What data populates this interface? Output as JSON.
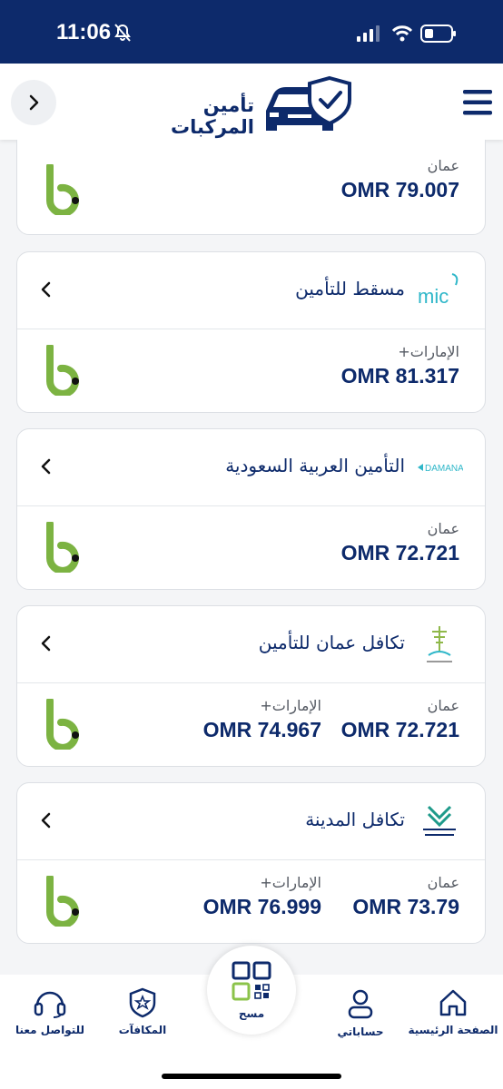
{
  "status_bar": {
    "time": "11:06"
  },
  "header": {
    "title": "تأمين المركبات"
  },
  "cards": [
    {
      "quotes": [
        {
          "region": "عمان",
          "price": "OMR 79.007"
        }
      ]
    },
    {
      "company": "مسقط للتأمين",
      "logo": "mic-logo",
      "quotes": [
        {
          "region": "+الإمارات",
          "price": "OMR 81.317"
        }
      ]
    },
    {
      "company": "التأمين العربية السعودية",
      "logo": "damana-logo",
      "quotes": [
        {
          "region": "عمان",
          "price": "OMR 72.721"
        }
      ]
    },
    {
      "company": "تكافل عمان للتأمين",
      "logo": "takaful-oman-logo",
      "quotes": [
        {
          "region": "عمان",
          "price": "OMR 72.721"
        },
        {
          "region": "+الإمارات",
          "price": "OMR 74.967"
        }
      ]
    },
    {
      "company": "تكافل المدينة",
      "logo": "al-madina-takaful-logo",
      "quotes": [
        {
          "region": "عمان",
          "price": "OMR 73.79"
        },
        {
          "region": "+الإمارات",
          "price": "OMR 76.999"
        }
      ]
    }
  ],
  "bottom_nav": {
    "home": "الصفحة الرئيسية",
    "accounts": "حساباتي",
    "scan": "مسح",
    "rewards": "المكافآت",
    "contact": "للتواصل معنا"
  },
  "colors": {
    "primary": "#0d2a6b",
    "accent_green": "#7cb342"
  }
}
